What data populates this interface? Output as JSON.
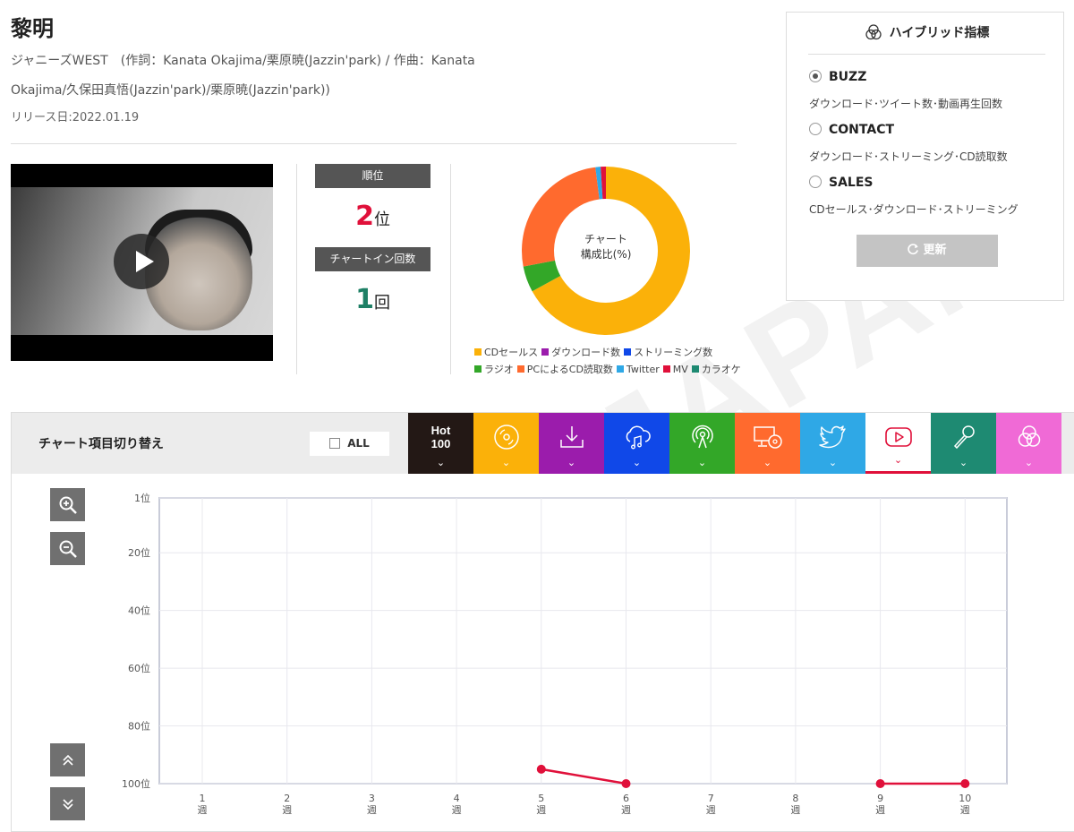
{
  "song": {
    "title": "黎明",
    "credits": "ジャニーズWEST　(作詞：Kanata Okajima/栗原暁(Jazzin'park) / 作曲：Kanata Okajima/久保田真悟(Jazzin'park)/栗原暁(Jazzin'park))",
    "release": "リリース日:2022.01.19"
  },
  "video": {
    "play_label": "play"
  },
  "rank": {
    "label": "順位",
    "value": "2",
    "unit": "位",
    "chartin_label": "チャートイン回数",
    "chartin_value": "1",
    "chartin_unit": "回"
  },
  "composition": {
    "center_line1": "チャート",
    "center_line2": "構成比(%)",
    "slices": [
      {
        "name": "CDセールス",
        "value": 67,
        "color": "#fbb109"
      },
      {
        "name": "ラジオ",
        "value": 5,
        "color": "#33a728"
      },
      {
        "name": "PCによるCD読取数",
        "value": 26,
        "color": "#ff6a2e"
      },
      {
        "name": "Twitter",
        "value": 1,
        "color": "#2fa8e6"
      },
      {
        "name": "MV",
        "value": 1,
        "color": "#e0103a"
      }
    ],
    "legend": [
      {
        "name": "CDセールス",
        "color": "#fbb109"
      },
      {
        "name": "ダウンロード数",
        "color": "#9b1cac"
      },
      {
        "name": "ストリーミング数",
        "color": "#1048e8"
      },
      {
        "name": "ラジオ",
        "color": "#33a728"
      },
      {
        "name": "PCによるCD読取数",
        "color": "#ff6a2e"
      },
      {
        "name": "Twitter",
        "color": "#2fa8e6"
      },
      {
        "name": "MV",
        "color": "#e0103a"
      },
      {
        "name": "カラオケ",
        "color": "#1e8a72"
      }
    ]
  },
  "hybrid": {
    "title": "ハイブリッド指標",
    "options": [
      {
        "label": "BUZZ",
        "desc": "ダウンロード･ツイート数･動画再生回数",
        "selected": true
      },
      {
        "label": "CONTACT",
        "desc": "ダウンロード･ストリーミング･CD読取数",
        "selected": false
      },
      {
        "label": "SALES",
        "desc": "CDセールス･ダウンロード･ストリーミング",
        "selected": false
      }
    ],
    "refresh_label": "更新"
  },
  "chart_panel": {
    "title": "チャート項目切り替え",
    "all_label": "ALL",
    "tabs": [
      {
        "name": "hot100",
        "label_line1": "Hot",
        "label_line2": "100",
        "color": "#231815",
        "icon": "hot100-text"
      },
      {
        "name": "cd-sales",
        "color": "#fbb109",
        "icon": "cd-icon"
      },
      {
        "name": "download",
        "color": "#9b1cac",
        "icon": "download-icon"
      },
      {
        "name": "streaming",
        "color": "#1048e8",
        "icon": "cloud-music-icon"
      },
      {
        "name": "radio",
        "color": "#33a728",
        "icon": "broadcast-icon"
      },
      {
        "name": "pc-cd-read",
        "color": "#ff6a2e",
        "icon": "pc-cd-icon"
      },
      {
        "name": "twitter",
        "color": "#2fa8e6",
        "icon": "twitter-icon"
      },
      {
        "name": "mv",
        "color": "#ffffff",
        "icon": "youtube-play-icon",
        "active": true
      },
      {
        "name": "karaoke",
        "color": "#1e8a72",
        "icon": "microphone-icon"
      },
      {
        "name": "hybrid",
        "color": "#f06ad6",
        "icon": "hybrid-circles-icon"
      }
    ],
    "chevron": "⌄",
    "controls": [
      "zoom-in-icon",
      "zoom-out-icon",
      "scroll-up-icon",
      "scroll-down-icon"
    ]
  },
  "chart_data": {
    "type": "line",
    "title": "",
    "x": [
      1,
      2,
      3,
      4,
      5,
      6,
      7,
      8,
      9,
      10
    ],
    "x_tick_labels": [
      [
        "1",
        "週"
      ],
      [
        "2",
        "週"
      ],
      [
        "3",
        "週"
      ],
      [
        "4",
        "週"
      ],
      [
        "5",
        "週"
      ],
      [
        "6",
        "週"
      ],
      [
        "7",
        "週"
      ],
      [
        "8",
        "週"
      ],
      [
        "9",
        "週"
      ],
      [
        "10",
        "週"
      ]
    ],
    "y_ticks": [
      1,
      20,
      40,
      60,
      80,
      100
    ],
    "y_tick_labels": [
      "1位",
      "20位",
      "40位",
      "60位",
      "80位",
      "100位"
    ],
    "ylim": [
      1,
      100
    ],
    "y_inverted": true,
    "grid": true,
    "series": [
      {
        "color": "#e0103a",
        "points": [
          [
            5,
            95
          ],
          [
            6,
            100
          ],
          null,
          null,
          [
            9,
            100
          ],
          [
            10,
            100
          ]
        ]
      }
    ]
  }
}
